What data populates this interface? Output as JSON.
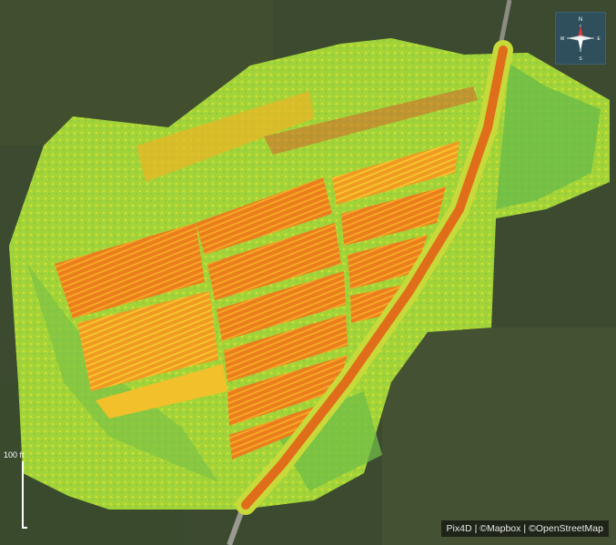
{
  "compass": {
    "north": "N",
    "south": "S",
    "east": "E",
    "west": "W",
    "icon": "compass-rose-icon"
  },
  "scale": {
    "label": "100 ft"
  },
  "attribution": {
    "items": [
      "Pix4D",
      "©Mapbox",
      "©OpenStreetMap"
    ],
    "separator": "|"
  },
  "colors": {
    "satellite_background": "#3a4a2e",
    "ndvi_low": "#e8651a",
    "ndvi_mid": "#f0d81e",
    "ndvi_high": "#5db84a",
    "road": "#e07a1c",
    "compass_bg": "#2f4f5c"
  }
}
